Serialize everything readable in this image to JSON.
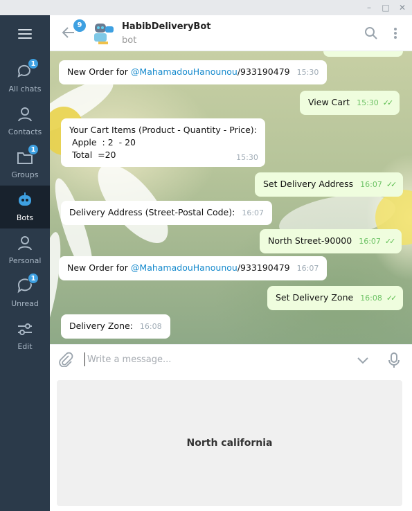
{
  "window": {
    "minimize_glyph": "–",
    "maximize_glyph": "□",
    "close_glyph": "✕"
  },
  "sidebar": {
    "menu_icon": "hamburger-menu-icon",
    "items": [
      {
        "label": "All chats",
        "icon": "chat-bubbles-icon",
        "badge": "1"
      },
      {
        "label": "Contacts",
        "icon": "person-icon",
        "badge": ""
      },
      {
        "label": "Groups",
        "icon": "folder-icon",
        "badge": "1"
      },
      {
        "label": "Bots",
        "icon": "bot-icon",
        "badge": "",
        "active": true
      },
      {
        "label": "Personal",
        "icon": "person-icon",
        "badge": ""
      },
      {
        "label": "Unread",
        "icon": "chat-bubble-icon",
        "badge": "1"
      },
      {
        "label": "Edit",
        "icon": "sliders-icon",
        "badge": ""
      }
    ]
  },
  "header": {
    "unread_badge": "9",
    "bot_name": "HabibDeliveryBot",
    "status": "bot"
  },
  "messages": [
    {
      "dir": "in",
      "pre": "New Order for ",
      "link": "@MahamadouHanounou",
      "post": "/933190479",
      "time": "15:30"
    },
    {
      "dir": "out",
      "text": "View Cart",
      "time": "15:30"
    },
    {
      "dir": "in",
      "lines": [
        "Your Cart Items (Product - Quantity - Price):",
        " Apple  : 2  - 20",
        " Total  =20"
      ],
      "time": "15:30"
    },
    {
      "dir": "out",
      "text": "Set Delivery Address",
      "time": "16:07"
    },
    {
      "dir": "in",
      "text": "Delivery Address (Street-Postal Code):",
      "time": "16:07"
    },
    {
      "dir": "out",
      "text": "North Street-90000",
      "time": "16:07"
    },
    {
      "dir": "in",
      "pre": "New Order for ",
      "link": "@MahamadouHanounou",
      "post": "/933190479",
      "time": "16:07"
    },
    {
      "dir": "out",
      "text": "Set Delivery Zone",
      "time": "16:08"
    },
    {
      "dir": "in",
      "text": "Delivery Zone:",
      "time": "16:08"
    }
  ],
  "composer": {
    "placeholder": "Write a message..."
  },
  "keyboard": {
    "button_label": "North california"
  },
  "colors": {
    "sidebar": "#2b3a4a",
    "active": "#18222d",
    "accent": "#3ea0e1",
    "out_bubble": "#effdde",
    "link": "#168acd"
  }
}
